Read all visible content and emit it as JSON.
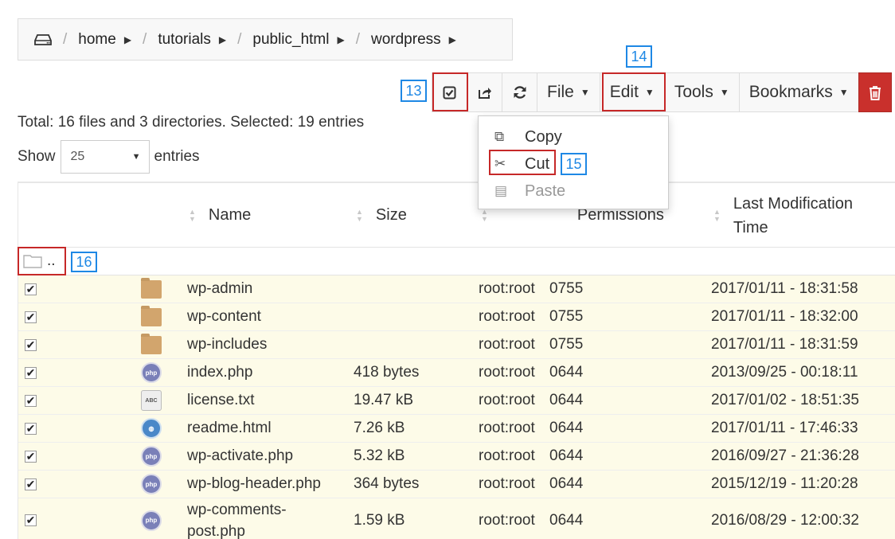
{
  "breadcrumb": {
    "items": [
      {
        "label": "home"
      },
      {
        "label": "tutorials"
      },
      {
        "label": "public_html"
      },
      {
        "label": "wordpress"
      }
    ],
    "root_icon": "drive-icon",
    "separator": "/"
  },
  "toolbar": {
    "select_all_icon": "check-square-icon",
    "share_icon": "share-icon",
    "refresh_icon": "refresh-icon",
    "file_label": "File",
    "edit_label": "Edit",
    "tools_label": "Tools",
    "bookmarks_label": "Bookmarks",
    "delete_icon": "trash-icon",
    "delete_color": "#c9302c"
  },
  "edit_menu": {
    "copy": "Copy",
    "cut": "Cut",
    "paste": "Paste"
  },
  "annotations": {
    "n13": "13",
    "n14": "14",
    "n15": "15",
    "n16": "16",
    "box_color": "#c62828",
    "label_color": "#1e88e5"
  },
  "summary": "Total: 16 files and 3 directories. Selected: 19 entries",
  "length": {
    "show_label": "Show",
    "value": "25",
    "entries_label": "entries"
  },
  "table": {
    "headers": {
      "name": "Name",
      "size": "Size",
      "permissions": "Permissions",
      "modified_line1": "Last Modification",
      "modified_line2": "Time"
    },
    "parent_label": "..",
    "rows": [
      {
        "name": "wp-admin",
        "size": "",
        "owner": "root:root",
        "perms": "0755",
        "mtime": "2017/01/11 - 18:31:58",
        "type": "folder"
      },
      {
        "name": "wp-content",
        "size": "",
        "owner": "root:root",
        "perms": "0755",
        "mtime": "2017/01/11 - 18:32:00",
        "type": "folder"
      },
      {
        "name": "wp-includes",
        "size": "",
        "owner": "root:root",
        "perms": "0755",
        "mtime": "2017/01/11 - 18:31:59",
        "type": "folder"
      },
      {
        "name": "index.php",
        "size": "418 bytes",
        "owner": "root:root",
        "perms": "0644",
        "mtime": "2013/09/25 - 00:18:11",
        "type": "php"
      },
      {
        "name": "license.txt",
        "size": "19.47 kB",
        "owner": "root:root",
        "perms": "0644",
        "mtime": "2017/01/02 - 18:51:35",
        "type": "txt"
      },
      {
        "name": "readme.html",
        "size": "7.26 kB",
        "owner": "root:root",
        "perms": "0644",
        "mtime": "2017/01/11 - 17:46:33",
        "type": "html"
      },
      {
        "name": "wp-activate.php",
        "size": "5.32 kB",
        "owner": "root:root",
        "perms": "0644",
        "mtime": "2016/09/27 - 21:36:28",
        "type": "php"
      },
      {
        "name": "wp-blog-header.php",
        "size": "364 bytes",
        "owner": "root:root",
        "perms": "0644",
        "mtime": "2015/12/19 - 11:20:28",
        "type": "php"
      },
      {
        "name": "wp-comments-post.php",
        "size": "1.59 kB",
        "owner": "root:root",
        "perms": "0644",
        "mtime": "2016/08/29 - 12:00:32",
        "type": "php"
      }
    ],
    "row_highlight_color": "#fdfbe8"
  }
}
